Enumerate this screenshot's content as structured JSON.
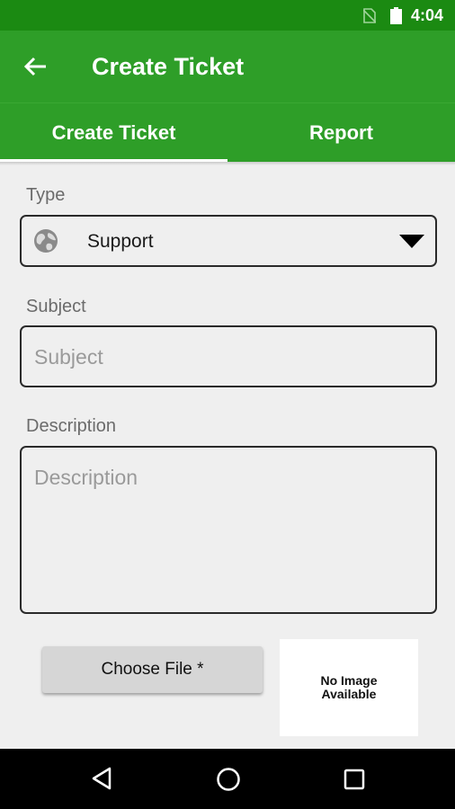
{
  "status_bar": {
    "time": "4:04",
    "icons": [
      "no-sim-icon",
      "battery-icon"
    ]
  },
  "app_bar": {
    "title": "Create Ticket",
    "back_icon": "arrow-left-icon"
  },
  "tabs": [
    {
      "label": "Create Ticket",
      "selected": true
    },
    {
      "label": "Report",
      "selected": false
    }
  ],
  "form": {
    "type": {
      "label": "Type",
      "value": "Support",
      "icon": "globe-icon"
    },
    "subject": {
      "label": "Subject",
      "placeholder": "Subject",
      "value": ""
    },
    "description": {
      "label": "Description",
      "placeholder": "Description",
      "value": ""
    },
    "choose_file_label": "Choose File *",
    "preview_text": "No Image Available"
  },
  "nav_bar": {
    "buttons": [
      "back-triangle-icon",
      "home-circle-icon",
      "recents-square-icon"
    ]
  },
  "colors": {
    "status_bar": "#1b8a12",
    "app_bar": "#2e9e28",
    "background": "#efefef"
  }
}
